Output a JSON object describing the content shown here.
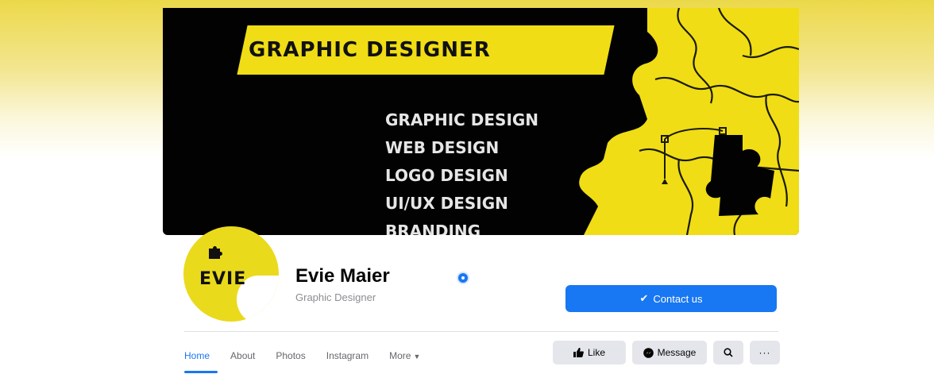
{
  "cover": {
    "headline": "GRAPHIC DESIGNER",
    "services": [
      "GRAPHIC DESIGN",
      "WEB DESIGN",
      "LOGO DESIGN",
      "UI/UX DESIGN",
      "BRANDING"
    ],
    "colors": {
      "accent_yellow": "#f0dd15",
      "background": "#020202"
    }
  },
  "profile": {
    "name": "Evie Maier",
    "subtitle": "Graphic Designer",
    "avatar_logo": "EVIE",
    "verified": true
  },
  "actions": {
    "contact_label": "Contact us",
    "like_label": "Like",
    "message_label": "Message",
    "brand_blue": "#1877f2"
  },
  "tabs": [
    {
      "label": "Home",
      "active": true
    },
    {
      "label": "About"
    },
    {
      "label": "Photos"
    },
    {
      "label": "Instagram"
    },
    {
      "label": "More"
    }
  ]
}
